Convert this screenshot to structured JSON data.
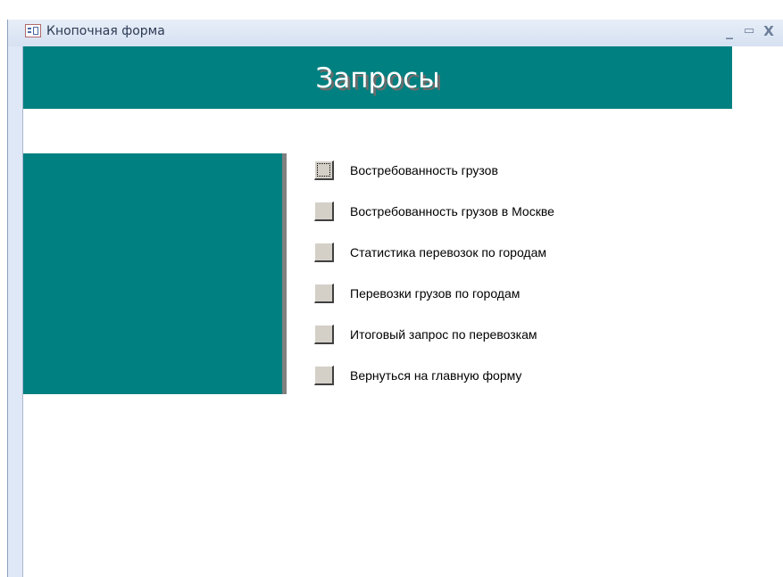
{
  "window": {
    "title": "Кнопочная форма",
    "controls": {
      "minimize": "_",
      "maximize": "▭",
      "close": "X"
    },
    "icon": "form-icon"
  },
  "form": {
    "title": "Запросы",
    "accent_color": "#008080",
    "items": [
      {
        "label": "Востребованность грузов",
        "focused": true
      },
      {
        "label": "Востребованность грузов в Москве",
        "focused": false
      },
      {
        "label": "Статистика перевозок по городам",
        "focused": false
      },
      {
        "label": "Перевозки грузов по городам",
        "focused": false
      },
      {
        "label": "Итоговый запрос по перевозкам",
        "focused": false
      },
      {
        "label": "Вернуться на главную форму",
        "focused": false
      }
    ]
  }
}
